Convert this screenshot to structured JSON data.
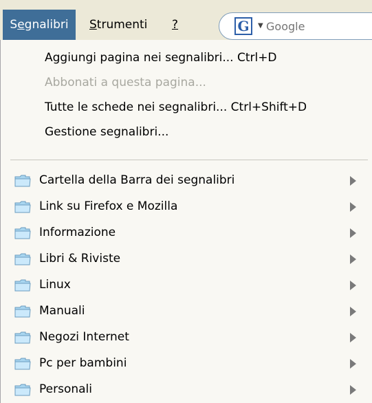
{
  "menubar": {
    "bookmarks_pre": "S",
    "bookmarks_ul": "e",
    "bookmarks_post": "gnalibri",
    "tools_ul": "S",
    "tools_post": "trumenti",
    "help_label": "?"
  },
  "search": {
    "engine_icon": "G",
    "placeholder": "Google"
  },
  "menu": {
    "actions": [
      {
        "label": "Aggiungi pagina nei segnalibri... Ctrl+D",
        "enabled": true
      },
      {
        "label": "Abbonati a questa pagina...",
        "enabled": false
      },
      {
        "label": "Tutte le schede nei segnalibri... Ctrl+Shift+D",
        "enabled": true
      },
      {
        "label": "Gestione segnalibri...",
        "enabled": true
      }
    ],
    "folders": [
      {
        "label": "Cartella della Barra dei segnalibri",
        "icon": "folder-icon"
      },
      {
        "label": "Link su Firefox e Mozilla",
        "icon": "folder-icon"
      },
      {
        "label": "Informazione",
        "icon": "folder-icon"
      },
      {
        "label": "Libri & Riviste",
        "icon": "folder-icon"
      },
      {
        "label": "Linux",
        "icon": "folder-icon"
      },
      {
        "label": "Manuali",
        "icon": "folder-icon"
      },
      {
        "label": "Negozi Internet",
        "icon": "folder-icon"
      },
      {
        "label": "Pc per bambini",
        "icon": "folder-icon"
      },
      {
        "label": "Personali",
        "icon": "folder-icon"
      }
    ]
  },
  "colors": {
    "menubar_bg": "#ece9d8",
    "active_bg": "#3f6e98",
    "menu_bg": "#f9f8f3",
    "disabled_text": "#a8a8a0"
  }
}
